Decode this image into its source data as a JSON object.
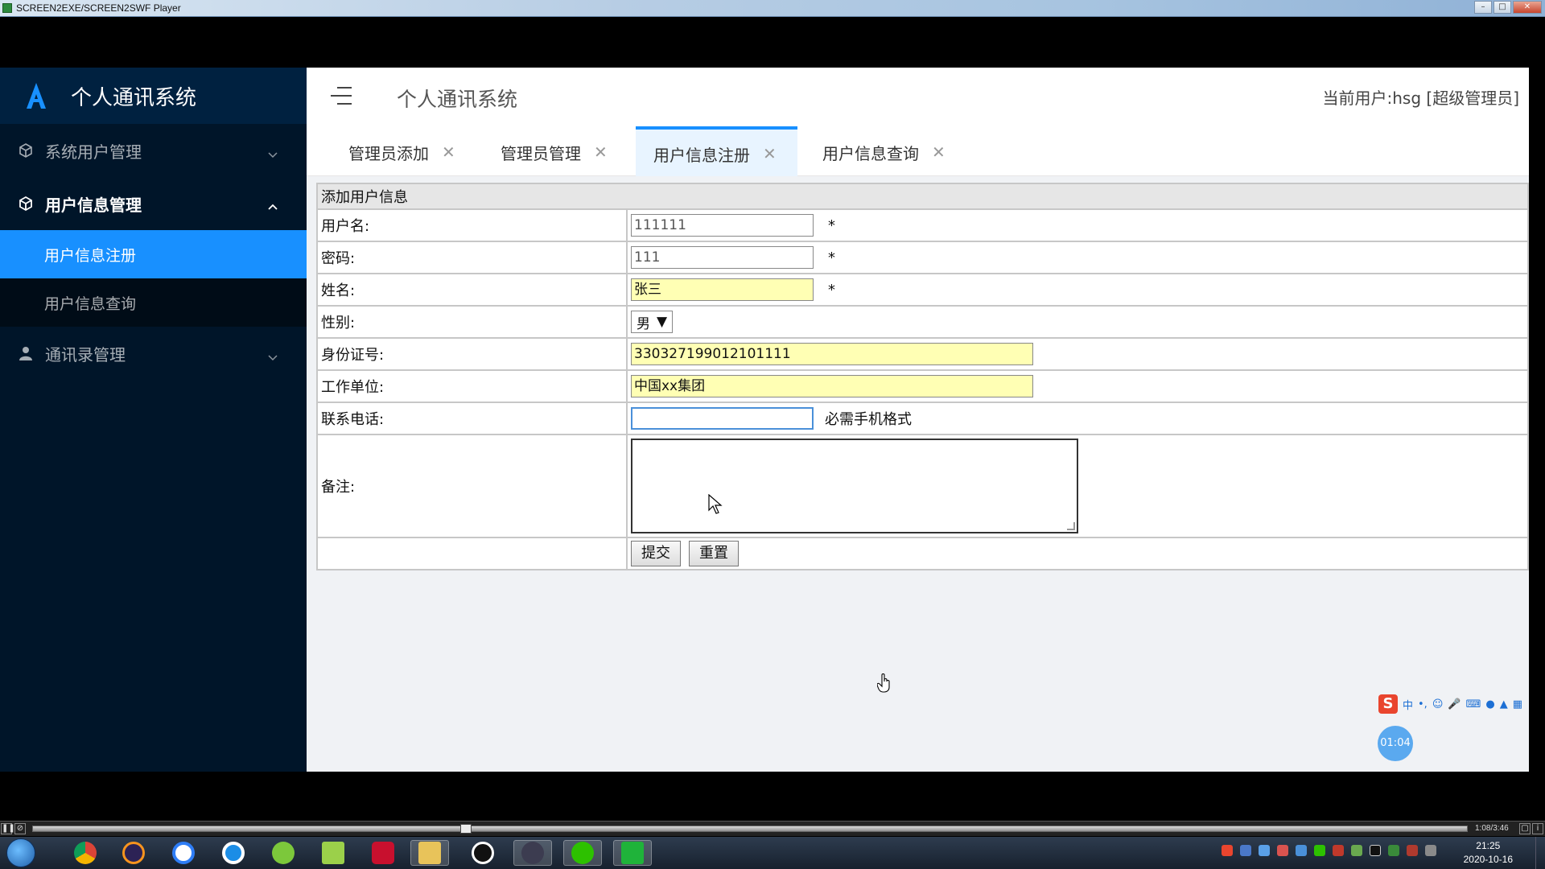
{
  "player": {
    "title": "SCREEN2EXE/SCREEN2SWF Player",
    "time": "1:08/3:46",
    "progress": 0.3
  },
  "sidebar": {
    "brand": "个人通讯系统",
    "menus": [
      {
        "label": "系统用户管理",
        "icon": "cube-icon",
        "expanded": false
      },
      {
        "label": "用户信息管理",
        "icon": "cube-icon",
        "expanded": true,
        "items": [
          {
            "label": "用户信息注册",
            "active": true
          },
          {
            "label": "用户信息查询",
            "active": false
          }
        ]
      },
      {
        "label": "通讯录管理",
        "icon": "user-icon",
        "expanded": false
      }
    ]
  },
  "header": {
    "title": "个人通讯系统",
    "user_info": "当前用户:hsg [超级管理员]"
  },
  "tabs": [
    {
      "label": "管理员添加",
      "active": false
    },
    {
      "label": "管理员管理",
      "active": false
    },
    {
      "label": "用户信息注册",
      "active": true
    },
    {
      "label": "用户信息查询",
      "active": false
    }
  ],
  "form": {
    "heading": "添加用户信息",
    "username": {
      "label": "用户名:",
      "value": "111111",
      "required": "*"
    },
    "password": {
      "label": "密码:",
      "value": "111",
      "required": "*"
    },
    "name": {
      "label": "姓名:",
      "value": "张三",
      "required": "*"
    },
    "gender": {
      "label": "性别:",
      "value": "男"
    },
    "idcard": {
      "label": "身份证号:",
      "value": "330327199012101111"
    },
    "workplace": {
      "label": "工作单位:",
      "value": "中国xx集团"
    },
    "phone": {
      "label": "联系电话:",
      "value": "",
      "hint": "必需手机格式"
    },
    "remark": {
      "label": "备注:",
      "value": ""
    },
    "submit_label": "提交",
    "reset_label": "重置"
  },
  "ime": {
    "mode": "中"
  },
  "timer": "01:04",
  "clock": {
    "time": "21:25",
    "date": "2020-10-16"
  },
  "colors": {
    "sidebar_bg": "#001529",
    "accent": "#1890ff",
    "autofill": "#ffffb4"
  }
}
